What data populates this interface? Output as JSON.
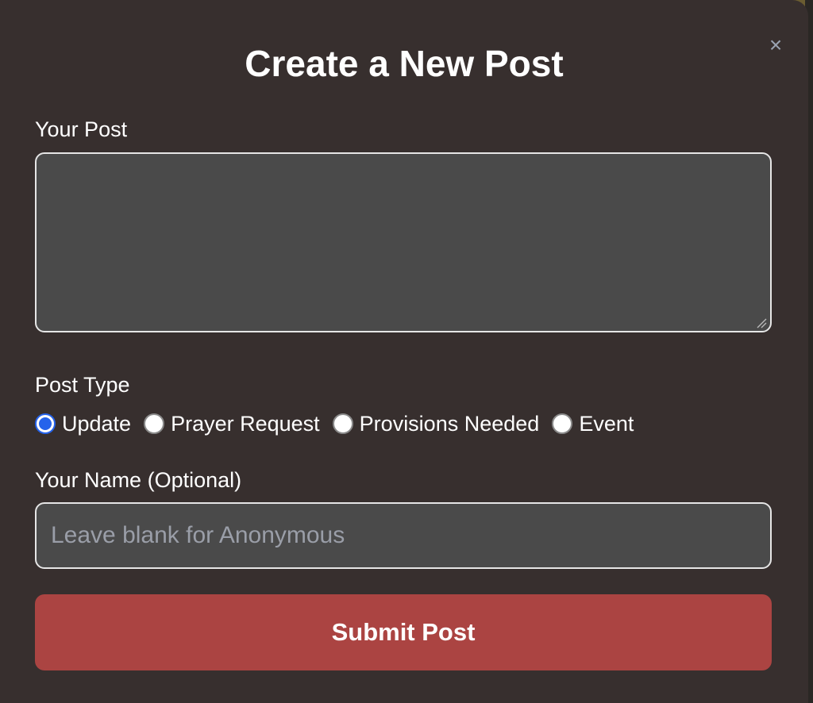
{
  "modal": {
    "title": "Create a New Post",
    "close_label": "×"
  },
  "post_field": {
    "label": "Your Post",
    "value": ""
  },
  "post_type": {
    "label": "Post Type",
    "options": [
      "Update",
      "Prayer Request",
      "Provisions Needed",
      "Event"
    ],
    "selected": "Update"
  },
  "name_field": {
    "label": "Your Name (Optional)",
    "placeholder": "Leave blank for Anonymous",
    "value": ""
  },
  "submit": {
    "label": "Submit Post"
  },
  "colors": {
    "modal_bg": "#372f2e",
    "input_bg": "#4a4a4a",
    "accent_button": "#ab4442",
    "radio_checked": "#2563eb"
  },
  "icons": {
    "close": "close-icon",
    "resize": "resize-grip-icon"
  }
}
